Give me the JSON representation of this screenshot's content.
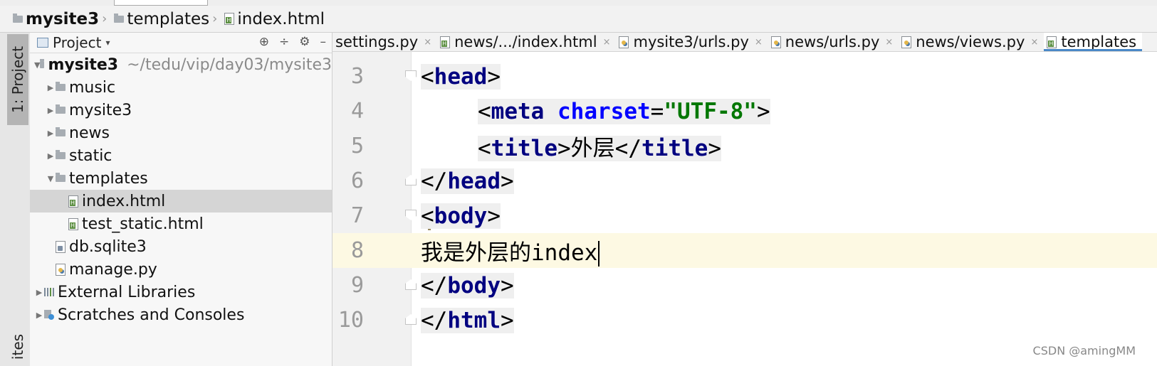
{
  "breadcrumb": [
    {
      "label": "mysite3",
      "bold": true,
      "icon": "folder-icon"
    },
    {
      "label": "templates",
      "bold": false,
      "icon": "folder-icon"
    },
    {
      "label": "index.html",
      "bold": false,
      "icon": "html-file-icon"
    }
  ],
  "left_strip": {
    "project_tab": "1: Project",
    "favorites_tab": "ites"
  },
  "project_panel": {
    "title": "Project",
    "tools": [
      "target-icon",
      "collapse-icon",
      "gear-icon",
      "hide-icon"
    ],
    "tree": [
      {
        "label": "mysite3",
        "path": "~/tedu/vip/day03/mysite3",
        "bold": true,
        "indent": 0,
        "arrow": "▼",
        "icon": "folder-icon"
      },
      {
        "label": "music",
        "indent": 1,
        "arrow": "▶",
        "icon": "folder-icon"
      },
      {
        "label": "mysite3",
        "indent": 1,
        "arrow": "▶",
        "icon": "folder-icon"
      },
      {
        "label": "news",
        "indent": 1,
        "arrow": "▶",
        "icon": "folder-icon"
      },
      {
        "label": "static",
        "indent": 1,
        "arrow": "▶",
        "icon": "folder-icon"
      },
      {
        "label": "templates",
        "indent": 1,
        "arrow": "▼",
        "icon": "folder-icon"
      },
      {
        "label": "index.html",
        "indent": 2,
        "arrow": "",
        "icon": "html-file-icon",
        "selected": true
      },
      {
        "label": "test_static.html",
        "indent": 2,
        "arrow": "",
        "icon": "html-file-icon"
      },
      {
        "label": "db.sqlite3",
        "indent": 1,
        "arrow": "",
        "icon": "file-icon"
      },
      {
        "label": "manage.py",
        "indent": 1,
        "arrow": "",
        "icon": "python-file-icon"
      },
      {
        "label": "External Libraries",
        "indent": 0,
        "arrow": "▶",
        "icon": "library-icon"
      },
      {
        "label": "Scratches and Consoles",
        "indent": 0,
        "arrow": "▶",
        "icon": "scratches-icon"
      }
    ]
  },
  "tabs": [
    {
      "label": "settings.py",
      "icon": "",
      "active": false
    },
    {
      "label": "news/.../index.html",
      "icon": "html-file-icon",
      "active": false
    },
    {
      "label": "mysite3/urls.py",
      "icon": "python-file-icon",
      "active": false
    },
    {
      "label": "news/urls.py",
      "icon": "python-file-icon",
      "active": false
    },
    {
      "label": "news/views.py",
      "icon": "python-file-icon",
      "active": false
    },
    {
      "label": "templates",
      "icon": "html-file-icon",
      "active": true
    }
  ],
  "code_lines": [
    {
      "num": "3",
      "fold": "open",
      "tokens": [
        [
          "tag-bracket",
          "<"
        ],
        [
          "tag",
          "head"
        ],
        [
          "tag-bracket",
          ">"
        ]
      ],
      "indent": 0
    },
    {
      "num": "4",
      "fold": "",
      "tokens": [
        [
          "tag-bracket",
          "<"
        ],
        [
          "tag",
          "meta"
        ],
        [
          "plain",
          " "
        ],
        [
          "attr",
          "charset"
        ],
        [
          "plain",
          "="
        ],
        [
          "str",
          "\"UTF-8\""
        ],
        [
          "tag-bracket",
          ">"
        ]
      ],
      "indent": 2
    },
    {
      "num": "5",
      "fold": "",
      "tokens": [
        [
          "tag-bracket",
          "<"
        ],
        [
          "tag",
          "title"
        ],
        [
          "tag-bracket",
          ">"
        ],
        [
          "plain",
          "外层"
        ],
        [
          "tag-bracket",
          "</"
        ],
        [
          "tag",
          "title"
        ],
        [
          "tag-bracket",
          ">"
        ]
      ],
      "indent": 2
    },
    {
      "num": "6",
      "fold": "close",
      "tokens": [
        [
          "tag-bracket",
          "</"
        ],
        [
          "tag",
          "head"
        ],
        [
          "tag-bracket",
          ">"
        ]
      ],
      "indent": 0
    },
    {
      "num": "7",
      "fold": "open",
      "tokens": [
        [
          "tag-bracket",
          "<"
        ],
        [
          "tag",
          "body"
        ],
        [
          "tag-bracket",
          ">"
        ]
      ],
      "indent": 0
    },
    {
      "num": "8",
      "fold": "",
      "tokens": [
        [
          "plain",
          "我是外层的index"
        ]
      ],
      "indent": 0,
      "caret": true
    },
    {
      "num": "9",
      "fold": "close",
      "tokens": [
        [
          "tag-bracket",
          "</"
        ],
        [
          "tag",
          "body"
        ],
        [
          "tag-bracket",
          ">"
        ]
      ],
      "indent": 0
    },
    {
      "num": "10",
      "fold": "close",
      "tokens": [
        [
          "tag-bracket",
          "</"
        ],
        [
          "tag",
          "html"
        ],
        [
          "tag-bracket",
          ">"
        ]
      ],
      "indent": 0
    }
  ],
  "watermark": "CSDN @amingMM"
}
